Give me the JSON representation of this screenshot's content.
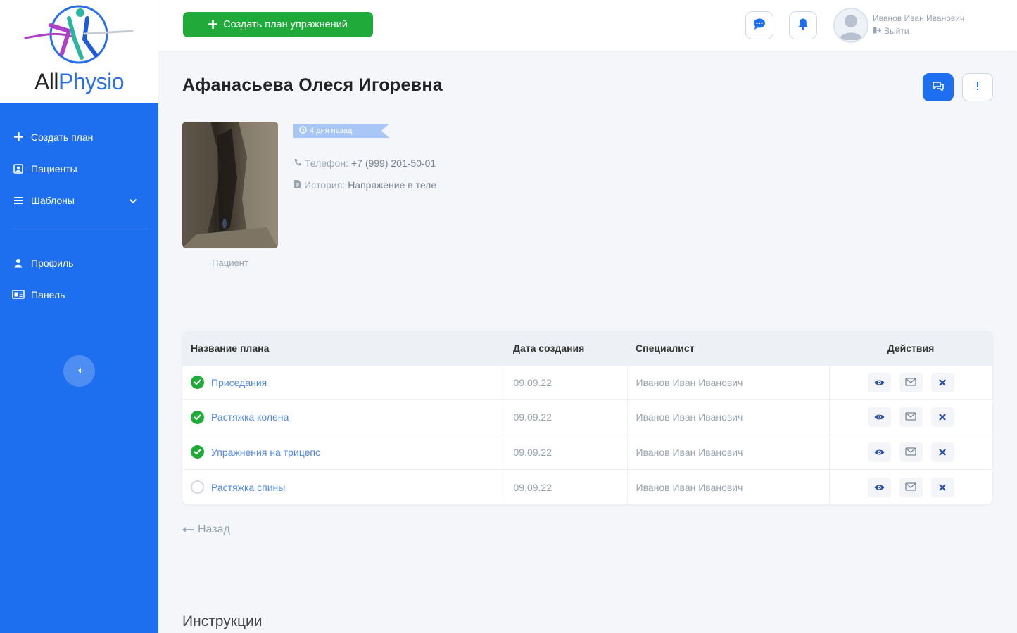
{
  "brand": {
    "part1": "All",
    "part2": "Physio"
  },
  "sidebar": {
    "items": [
      {
        "label": "Создать план",
        "icon": "plus-icon"
      },
      {
        "label": "Пациенты",
        "icon": "patients-icon"
      },
      {
        "label": "Шаблоны",
        "icon": "list-icon"
      }
    ],
    "items2": [
      {
        "label": "Профиль",
        "icon": "user-icon"
      },
      {
        "label": "Панель",
        "icon": "dashboard-icon"
      }
    ]
  },
  "topbar": {
    "create_label": "Создать план упражнений",
    "user_name": "Иванов Иван Иванович",
    "logout_label": "Выйти"
  },
  "patient": {
    "name": "Афанасьева Олеся Игоревна",
    "photo_caption": "Пациент",
    "time_badge": "4 дня назад",
    "phone_label": "Телефон:",
    "phone_value": "+7 (999) 201-50-01",
    "history_label": "История:",
    "history_value": "Напряжение в теле"
  },
  "table": {
    "headers": [
      "Название плана",
      "Дата создания",
      "Специалист",
      "Действия"
    ],
    "rows": [
      {
        "plan": "Приседания",
        "date": "09.09.22",
        "specialist": "Иванов Иван Иванович",
        "status": "done"
      },
      {
        "plan": "Растяжка колена",
        "date": "09.09.22",
        "specialist": "Иванов Иван Иванович",
        "status": "done"
      },
      {
        "plan": "Упражнения на трицепс",
        "date": "09.09.22",
        "specialist": "Иванов Иван Иванович",
        "status": "done"
      },
      {
        "plan": "Растяжка спины",
        "date": "09.09.22",
        "specialist": "Иванов Иван Иванович",
        "status": "pending"
      }
    ]
  },
  "back_label": "Назад",
  "instructions_title": "Инструкции",
  "colors": {
    "primary": "#1d6ff0",
    "success": "#1faa3a",
    "muted": "#9aa3b2"
  }
}
